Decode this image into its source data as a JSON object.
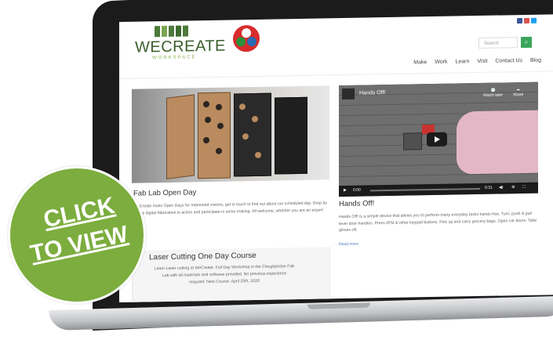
{
  "site": {
    "logo_main": "WECREATE",
    "logo_sub": "WORKSPACE",
    "search_placeholder": "Search",
    "nav": [
      "Make",
      "Work",
      "Learn",
      "Visit",
      "Contact Us",
      "Blog"
    ]
  },
  "posts": {
    "left_title": "Fab Lab Open Day",
    "left_text": "WeCreate hosts Open Days for Interested visitors, get in touch to find out about our scheduled day. Drop by to see digital fabrication in action and participate in some making. All welcome, whether you are an expert",
    "course_title": "Laser Cutting One Day Course",
    "course_text": "Learn Laser cutting at WeCreate. Full Day Workshop in the Cloughjordan Fab Lab with all materials and software provided. No previous experience required. Next Course: April 25th, 2020",
    "right_title": "Hands Off!",
    "right_text": "Hands Off! is a simple device that allows you to perform many everyday tasks hands free. Turn, push & pull lever door handles. Press ATM & other keypad buttons. Pick up and carry grocery bags. Open car doors. Take gloves off.",
    "read_more": "Read more"
  },
  "video": {
    "title": "Hands Off!",
    "watch_later": "Watch later",
    "share": "Share",
    "time_start": "0:00",
    "time_end": "0:31"
  },
  "overlay": {
    "line1": "CLICK",
    "line2": "TO VIEW"
  },
  "colors": {
    "accent_green": "#7cad3e",
    "search_green": "#3aa55a"
  }
}
